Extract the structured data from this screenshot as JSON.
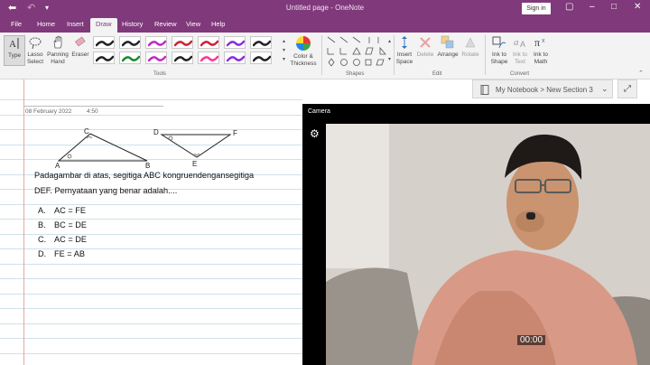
{
  "window": {
    "title": "Untitled page  -  OneNote",
    "signin_label": "Sign in",
    "back_icon": "back-arrow-icon",
    "undo_icon": "undo-icon",
    "qat_icon": "customize-icon"
  },
  "tabs": [
    {
      "label": "File"
    },
    {
      "label": "Home"
    },
    {
      "label": "Insert"
    },
    {
      "label": "Draw"
    },
    {
      "label": "History"
    },
    {
      "label": "Review"
    },
    {
      "label": "View"
    },
    {
      "label": "Help"
    }
  ],
  "ribbon": {
    "type_label": "Type",
    "lasso_label": "Lasso Select",
    "panning_label": "Panning Hand",
    "eraser_label": "Eraser",
    "tools_group": "Tools",
    "color_label": "Color & Thickness",
    "shapes_group": "Shapes",
    "insert_space_label": "Insert Space",
    "delete_label": "Delete",
    "arrange_label": "Arrange",
    "rotate_label": "Rotate",
    "edit_group": "Edit",
    "ink_to_shape_label": "Ink to Shape",
    "ink_to_text_label": "Ink to Text",
    "ink_to_math_label": "Ink to Math",
    "convert_group": "Convert",
    "pens_row1": [
      "#222222",
      "#222222",
      "#c02ac0",
      "#cc2233",
      "#cc2233",
      "#8a2be2",
      "#222222"
    ],
    "pens_row2": [
      "#222222",
      "#1a8a2a",
      "#c02ac0",
      "#222222",
      "#ff3399",
      "#8a2be2",
      "#222222"
    ]
  },
  "navigation": {
    "crumb": "My Notebook > New Section 3",
    "expand_icon": "expand-icon"
  },
  "note": {
    "date": "08 February 2022",
    "time": "4:50",
    "triangle1": {
      "a": "A",
      "b": "B",
      "c": "C"
    },
    "triangle2": {
      "d": "D",
      "e": "E",
      "f": "F"
    },
    "question_line1": "Padagambar di atas, segitiga ABC kongruendengansegitiga",
    "question_line2": "DEF. Pernyataan yang benar adalah....",
    "options": [
      {
        "letter": "A.",
        "text": "AC = FE"
      },
      {
        "letter": "B.",
        "text": "BC = DE"
      },
      {
        "letter": "C.",
        "text": "AC = DE"
      },
      {
        "letter": "D.",
        "text": "FE = AB"
      }
    ]
  },
  "camera": {
    "title": "Camera",
    "settings_icon": "gear-icon",
    "timer": "00:00"
  },
  "colors": {
    "brand": "#80397b",
    "ribbon": "#f3f3f3",
    "margin": "#e7a6a6",
    "rule": "#cfe1ea"
  }
}
